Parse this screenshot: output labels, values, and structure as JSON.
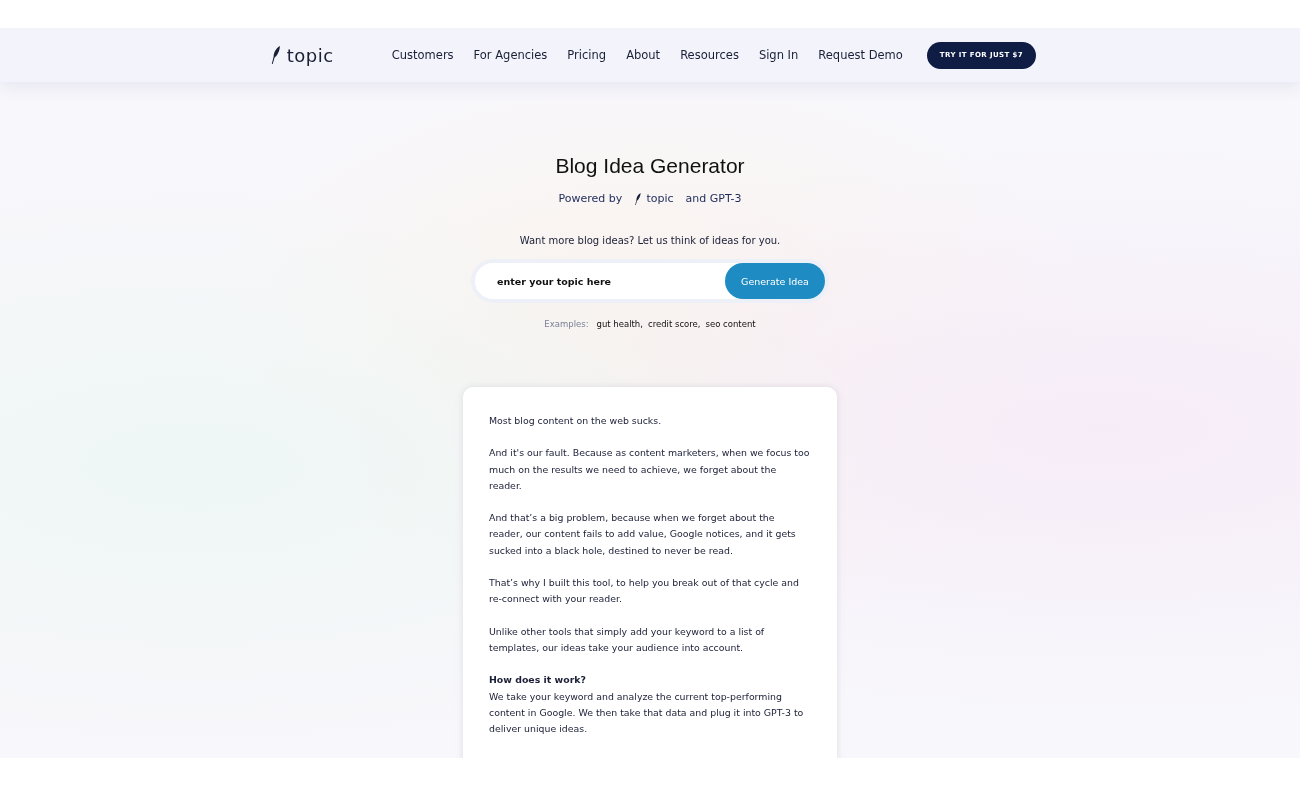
{
  "header": {
    "logo": "topic",
    "nav": [
      "Customers",
      "For Agencies",
      "Pricing",
      "About",
      "Resources",
      "Sign In",
      "Request Demo"
    ],
    "cta": "TRY IT FOR JUST $7"
  },
  "hero": {
    "title": "Blog Idea Generator",
    "powered_by": "Powered by",
    "powered_logo": "topic",
    "powered_suffix": "and GPT-3",
    "prompt": "Want more blog ideas? Let us think of ideas for you.",
    "input": {
      "placeholder": "enter your topic here"
    },
    "button": "Generate Idea",
    "examples_label": "Examples:",
    "examples": [
      "gut health,",
      "credit score,",
      "seo content"
    ]
  },
  "card": {
    "blocks": [
      {
        "kind": "paragraph",
        "text": "Most blog content on the web sucks."
      },
      {
        "kind": "paragraph",
        "text": "And it's our fault. Because as content marketers, when we focus too much on the results we need to achieve, we forget about the reader."
      },
      {
        "kind": "paragraph",
        "text": "And that’s a big problem, because when we forget about the reader, our content fails to add value, Google notices, and it gets sucked into a black hole, destined to never be read."
      },
      {
        "kind": "paragraph",
        "text": "That’s why I built this tool, to help you break out of that cycle and re-connect with your reader."
      },
      {
        "kind": "paragraph",
        "text": "Unlike other tools that simply add your keyword to a list of templates, our ideas take your audience into account."
      },
      {
        "kind": "heading",
        "text": "How does it work?"
      },
      {
        "kind": "paragraph",
        "text": "We take your keyword and analyze the current top-performing content in Google. We then take that data and plug it into GPT-3 to deliver unique ideas."
      }
    ]
  }
}
